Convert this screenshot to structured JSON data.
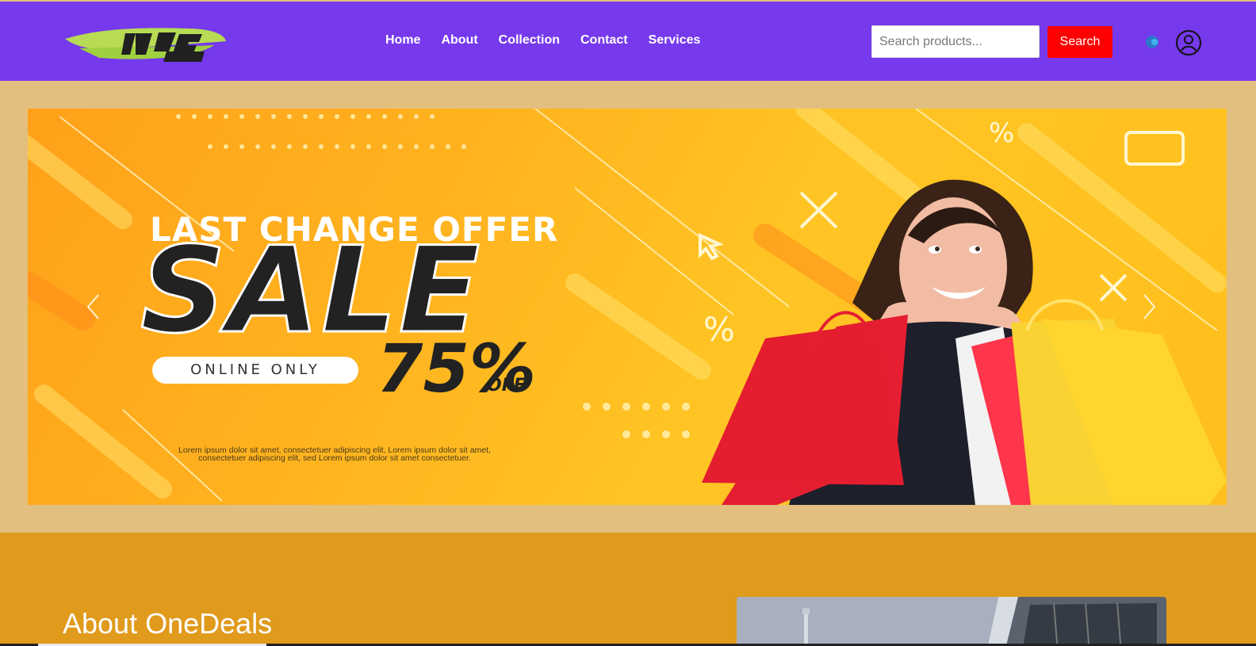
{
  "header": {
    "logo_name": "one-deal-logo",
    "nav": [
      {
        "label": "Home"
      },
      {
        "label": "About"
      },
      {
        "label": "Collection"
      },
      {
        "label": "Contact"
      },
      {
        "label": "Services"
      }
    ],
    "search": {
      "placeholder": "Search products...",
      "value": "",
      "button_label": "Search"
    },
    "icons": [
      "blue-dot-icon",
      "user-icon"
    ]
  },
  "hero": {
    "subtitle": "LAST CHANGE OFFER",
    "title": "SALE",
    "pill": "ONLINE ONLY",
    "discount": "75%",
    "discount_suffix": "OFF",
    "copy": "Lorem ipsum dolor sit amet, consectetuer adipiscing elit, Lorem ipsum dolor sit amet, consectetuer adipiscing elit, sed Lorem ipsum dolor sit amet consectetuer.",
    "controls": [
      "chevron-left-icon",
      "chevron-right-icon"
    ]
  },
  "about": {
    "heading": "About OneDeals"
  },
  "colors": {
    "header": "#7639ec",
    "hero_background": "#e3bf7f",
    "banner_yellow": "#ffbf1c",
    "search_button": "#ff0000",
    "about_background": "#e09a1c"
  }
}
